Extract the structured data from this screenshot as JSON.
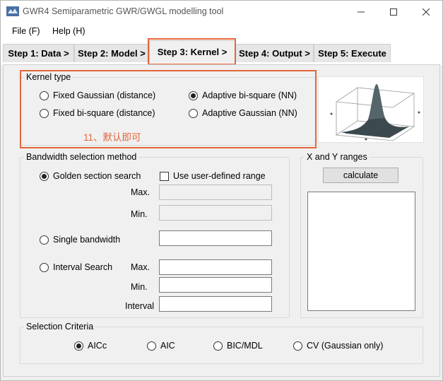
{
  "window": {
    "title": "GWR4  Semiparametric GWR/GWGL modelling tool",
    "app_icon": "gwr4-logo-icon"
  },
  "menu": [
    "File (F)",
    "Help (H)"
  ],
  "tabs": [
    {
      "label": "Step 1: Data >"
    },
    {
      "label": "Step 2: Model >"
    },
    {
      "label": "Step 3: Kernel >"
    },
    {
      "label": "Step 4: Output >"
    },
    {
      "label": "Step 5: Execute"
    }
  ],
  "kernel": {
    "legend": "Kernel type",
    "options": [
      {
        "label": "Fixed Gaussian (distance)",
        "selected": false
      },
      {
        "label": "Adaptive bi-square (NN)",
        "selected": true
      },
      {
        "label": "Fixed bi-square (distance)",
        "selected": false
      },
      {
        "label": "Adaptive Gaussian (NN)",
        "selected": false
      }
    ],
    "annotation": "11、默认即可",
    "annotation_color": "#e2673c",
    "surface_icon": "3d-kernel-surface-plot"
  },
  "bandwidth": {
    "legend": "Bandwidth selection method",
    "golden": "Golden section search",
    "user_defined": "Use user-defined range",
    "max_label": "Max.",
    "min_label": "Min.",
    "single": "Single bandwidth",
    "interval": "Interval Search",
    "interval_max": "Max.",
    "interval_min": "Min.",
    "interval_step": "Interval"
  },
  "xy": {
    "legend": "X and Y ranges",
    "calculate": "calculate"
  },
  "criteria": {
    "legend": "Selection Criteria",
    "options": [
      {
        "label": "AICc",
        "selected": true
      },
      {
        "label": "AIC",
        "selected": false
      },
      {
        "label": "BIC/MDL",
        "selected": false
      },
      {
        "label": "CV (Gaussian only)",
        "selected": false
      }
    ]
  }
}
